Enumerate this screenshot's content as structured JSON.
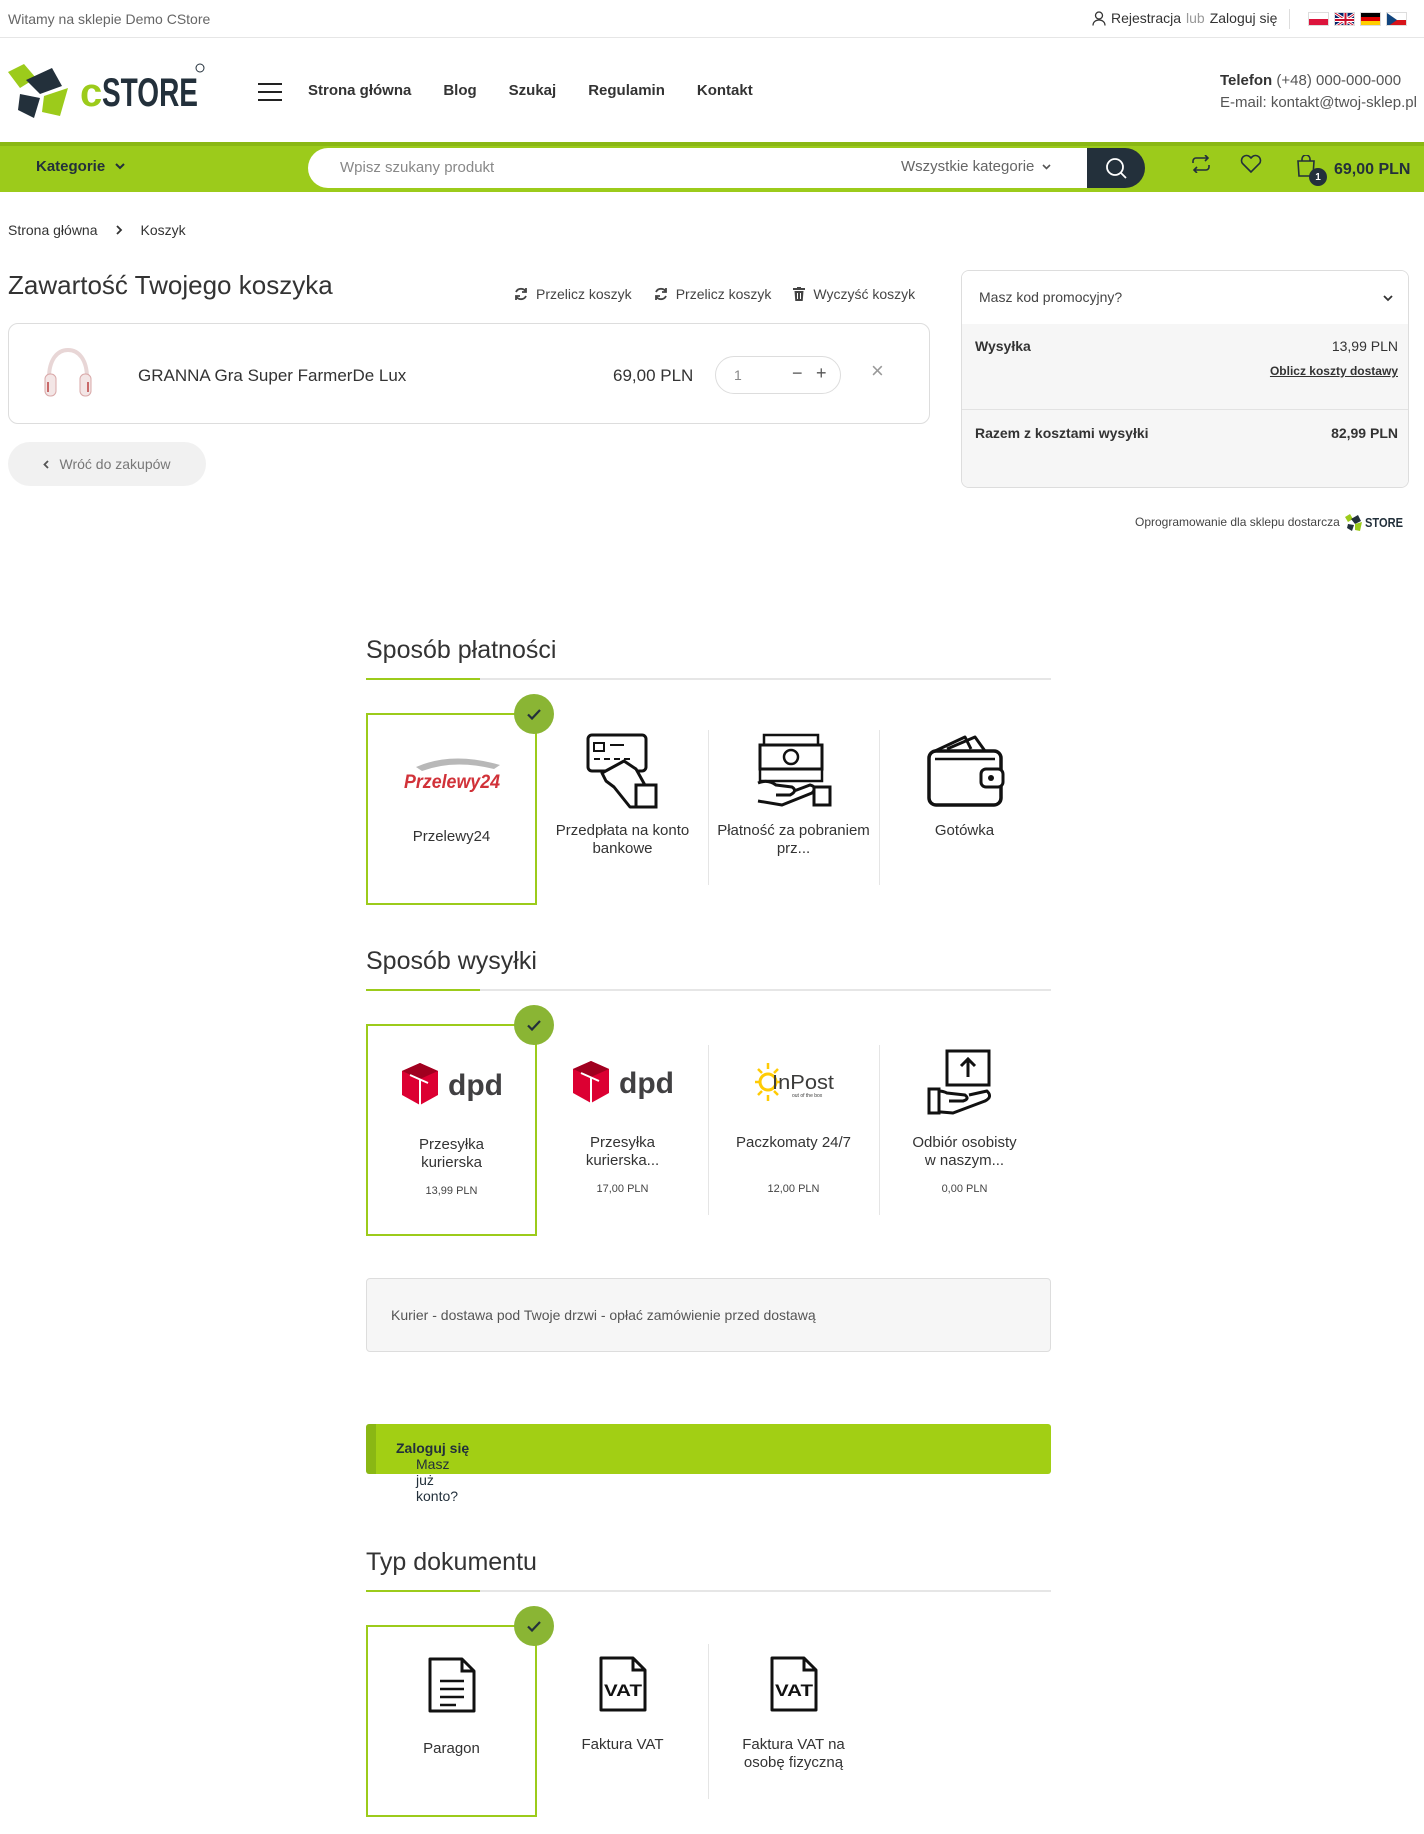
{
  "topbar": {
    "welcome": "Witamy na sklepie Demo CStore",
    "register": "Rejestracja",
    "or": "lub",
    "login": "Zaloguj się"
  },
  "brand": {
    "name": "STORE",
    "initial": "c",
    "accent": "#9ccb1b",
    "dark": "#23303b"
  },
  "nav": [
    {
      "label": "Strona główna"
    },
    {
      "label": "Blog"
    },
    {
      "label": "Szukaj"
    },
    {
      "label": "Regulamin"
    },
    {
      "label": "Kontakt"
    }
  ],
  "contact": {
    "phone_label": "Telefon",
    "phone": "(+48) 000-000-000",
    "email": "E-mail: kontakt@twoj-sklep.pl"
  },
  "bar": {
    "categories": "Kategorie",
    "search_placeholder": "Wpisz szukany produkt",
    "search_category": "Wszystkie kategorie",
    "cart_count": "1",
    "cart_total": "69,00 PLN"
  },
  "breadcrumb": [
    "Strona główna",
    "Koszyk"
  ],
  "cart": {
    "title": "Zawartość Twojego koszyka",
    "recalc1": "Przelicz koszyk",
    "recalc2": "Przelicz koszyk",
    "clear": "Wyczyść koszyk",
    "item": {
      "name": "GRANNA Gra Super FarmerDe Lux",
      "price": "69,00 PLN",
      "qty": "1"
    },
    "back": "Wróć do zakupów"
  },
  "summary": {
    "promo": "Masz kod promocyjny?",
    "shipping_label": "Wysyłka",
    "shipping_value": "13,99 PLN",
    "calc_link": "Oblicz koszty dostawy",
    "total_label": "Razem z kosztami wysyłki",
    "total_value": "82,99 PLN"
  },
  "powered": {
    "text": "Oprogramowanie dla sklepu dostarcza",
    "brand": "STORE"
  },
  "payment": {
    "title": "Sposób płatności",
    "options": [
      {
        "label": "Przelewy24",
        "logo": "Przelewy24"
      },
      {
        "label": "Przedpłata na konto bankowe"
      },
      {
        "label": "Płatność za pobraniem prz..."
      },
      {
        "label": "Gotówka"
      }
    ]
  },
  "shipping": {
    "title": "Sposób wysyłki",
    "options": [
      {
        "label": "Przesyłka kurierska",
        "price": "13,99 PLN",
        "logo": "dpd"
      },
      {
        "label": "Przesyłka kurierska...",
        "price": "17,00 PLN",
        "logo": "dpd"
      },
      {
        "label": "Paczkomaty 24/7",
        "price": "12,00 PLN",
        "logo": "InPost",
        "logo_sub": "out of the box"
      },
      {
        "label": "Odbiór osobisty w naszym...",
        "price": "0,00 PLN"
      }
    ],
    "info": "Kurier - dostawa pod Twoje drzwi - opłać zamówienie przed dostawą"
  },
  "account": {
    "question": "Masz już konto?",
    "link": "Zaloguj się"
  },
  "document": {
    "title": "Typ dokumentu",
    "vat_icon_text": "VAT",
    "options": [
      {
        "label": "Paragon"
      },
      {
        "label": "Faktura VAT"
      },
      {
        "label": "Faktura VAT na osobę fizyczną"
      }
    ]
  }
}
